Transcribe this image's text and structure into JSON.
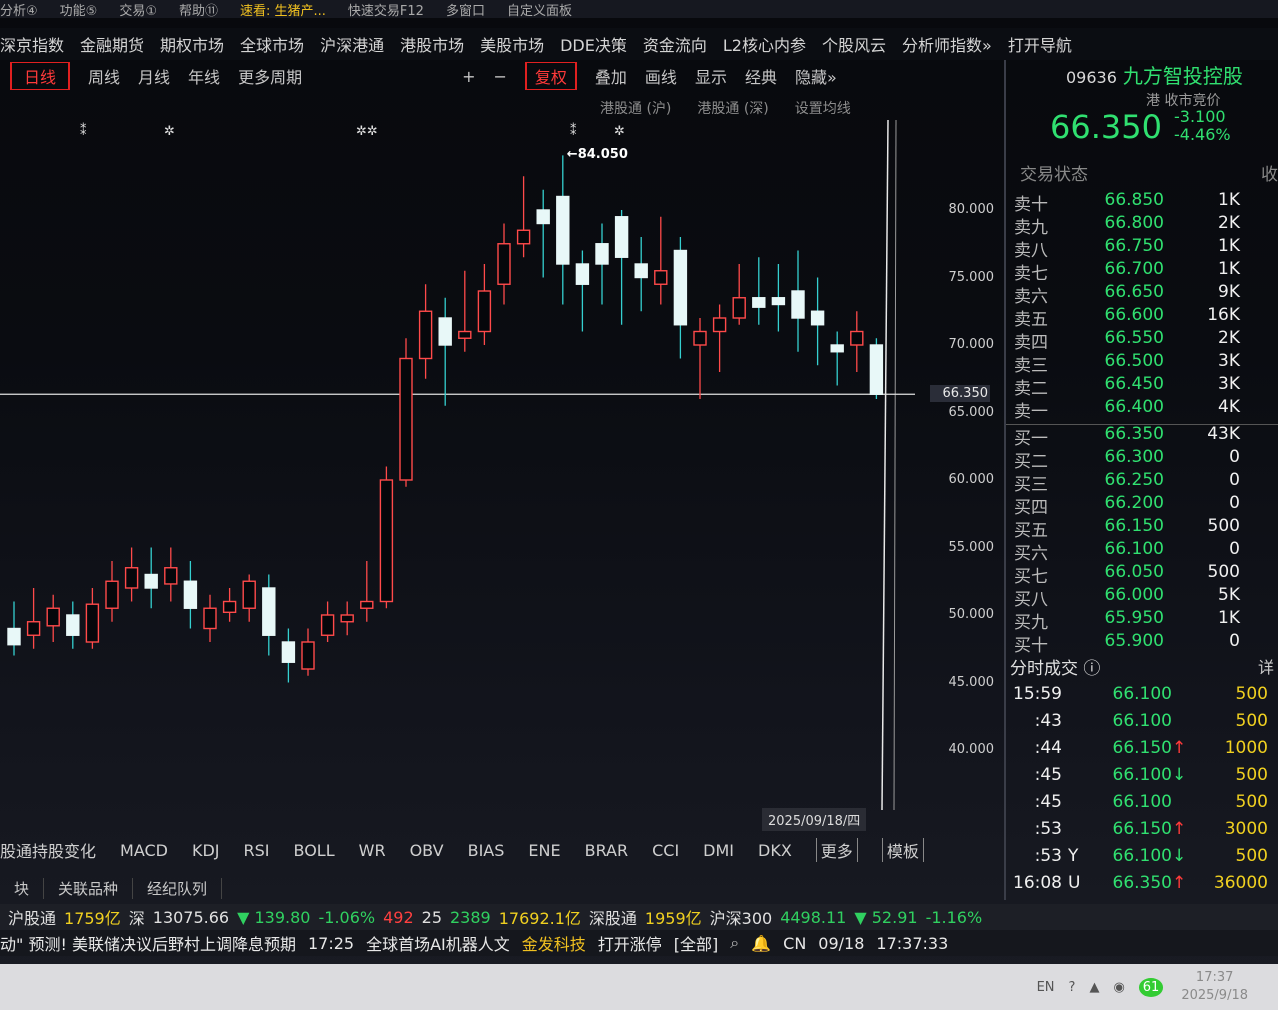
{
  "menu": {
    "items": [
      "分析④",
      "功能⑤",
      "交易①",
      "帮助⑪",
      "速看: 生猪产...",
      "快速交易F12",
      "多窗口",
      "自定义面板"
    ]
  },
  "nav": {
    "items": [
      "深京指数",
      "金融期货",
      "期权市场",
      "全球市场",
      "沪深港通",
      "港股市场",
      "美股市场",
      "DDE决策",
      "资金流向",
      "L2核心内参",
      "个股风云",
      "分析师指数»",
      "打开导航"
    ]
  },
  "toolbar": {
    "items": [
      "日线",
      "周线",
      "月线",
      "年线",
      "更多周期",
      "+",
      "−",
      "复权",
      "叠加",
      "画线",
      "显示",
      "经典",
      "隐藏»"
    ]
  },
  "subbar": {
    "items": [
      "港股通 (沪)",
      "港股通 (深)",
      "设置均线"
    ]
  },
  "chart": {
    "y_ticks": [
      "80.000",
      "75.000",
      "70.000",
      "65.000",
      "60.000",
      "55.000",
      "50.000",
      "45.000",
      "40.000"
    ],
    "current_price_tag": "66.350",
    "high_label": "84.050",
    "date_label": "2025/09/18/四"
  },
  "chart_data": {
    "type": "candlestick",
    "current_price": 66.35,
    "period_high": 84.05,
    "ylim": [
      37,
      85
    ],
    "candles": [
      {
        "o": 49.0,
        "c": 47.8,
        "h": 51,
        "l": 47
      },
      {
        "o": 48.5,
        "c": 49.5,
        "h": 52,
        "l": 47.5
      },
      {
        "o": 49.2,
        "c": 50.5,
        "h": 51.5,
        "l": 48
      },
      {
        "o": 50.0,
        "c": 48.5,
        "h": 51,
        "l": 47.5
      },
      {
        "o": 48.0,
        "c": 50.8,
        "h": 52,
        "l": 47.5
      },
      {
        "o": 50.5,
        "c": 52.5,
        "h": 54,
        "l": 49.5
      },
      {
        "o": 52.0,
        "c": 53.5,
        "h": 55,
        "l": 51
      },
      {
        "o": 53.0,
        "c": 52.0,
        "h": 55,
        "l": 50.5
      },
      {
        "o": 52.3,
        "c": 53.5,
        "h": 55,
        "l": 51
      },
      {
        "o": 52.5,
        "c": 50.5,
        "h": 54,
        "l": 49
      },
      {
        "o": 49.0,
        "c": 50.5,
        "h": 51.5,
        "l": 48
      },
      {
        "o": 50.2,
        "c": 51.0,
        "h": 52,
        "l": 49.5
      },
      {
        "o": 50.5,
        "c": 52.5,
        "h": 53,
        "l": 49.5
      },
      {
        "o": 52.0,
        "c": 48.5,
        "h": 53,
        "l": 47
      },
      {
        "o": 48.0,
        "c": 46.5,
        "h": 49,
        "l": 45
      },
      {
        "o": 46.0,
        "c": 48.0,
        "h": 49,
        "l": 45.5
      },
      {
        "o": 48.5,
        "c": 50.0,
        "h": 51,
        "l": 48
      },
      {
        "o": 49.5,
        "c": 50.0,
        "h": 51,
        "l": 48.5
      },
      {
        "o": 50.5,
        "c": 51.0,
        "h": 54,
        "l": 49.5
      },
      {
        "o": 51.0,
        "c": 60.0,
        "h": 61,
        "l": 50.5
      },
      {
        "o": 60.0,
        "c": 69.0,
        "h": 70.5,
        "l": 59.5
      },
      {
        "o": 69.0,
        "c": 72.5,
        "h": 74.5,
        "l": 67.5
      },
      {
        "o": 72.0,
        "c": 70.0,
        "h": 73.5,
        "l": 65.5
      },
      {
        "o": 70.5,
        "c": 71.0,
        "h": 75.5,
        "l": 69.5
      },
      {
        "o": 71.0,
        "c": 74.0,
        "h": 76,
        "l": 70
      },
      {
        "o": 74.5,
        "c": 77.5,
        "h": 79,
        "l": 73
      },
      {
        "o": 77.5,
        "c": 78.5,
        "h": 82.5,
        "l": 76.5
      },
      {
        "o": 80.0,
        "c": 79.0,
        "h": 81.5,
        "l": 75
      },
      {
        "o": 81.0,
        "c": 76.0,
        "h": 84.05,
        "l": 73
      },
      {
        "o": 76.0,
        "c": 74.5,
        "h": 77,
        "l": 71
      },
      {
        "o": 77.5,
        "c": 76.0,
        "h": 79,
        "l": 73
      },
      {
        "o": 79.5,
        "c": 76.5,
        "h": 80,
        "l": 71.5
      },
      {
        "o": 76.0,
        "c": 75.0,
        "h": 78,
        "l": 72.5
      },
      {
        "o": 74.5,
        "c": 75.5,
        "h": 79.5,
        "l": 73
      },
      {
        "o": 77.0,
        "c": 71.5,
        "h": 78,
        "l": 69
      },
      {
        "o": 70.0,
        "c": 71.0,
        "h": 72,
        "l": 66
      },
      {
        "o": 71.0,
        "c": 72.0,
        "h": 73,
        "l": 68
      },
      {
        "o": 72.0,
        "c": 73.5,
        "h": 76,
        "l": 71.5
      },
      {
        "o": 73.5,
        "c": 72.8,
        "h": 76.5,
        "l": 71.5
      },
      {
        "o": 73.5,
        "c": 73.0,
        "h": 76,
        "l": 71
      },
      {
        "o": 74.0,
        "c": 72.0,
        "h": 77,
        "l": 69.5
      },
      {
        "o": 72.5,
        "c": 71.5,
        "h": 75,
        "l": 68.5
      },
      {
        "o": 70.0,
        "c": 69.5,
        "h": 71,
        "l": 67
      },
      {
        "o": 70.0,
        "c": 71.0,
        "h": 72.5,
        "l": 68
      },
      {
        "o": 70.0,
        "c": 66.35,
        "h": 70.5,
        "l": 66.0
      }
    ]
  },
  "indicators": {
    "items": [
      "股通持股变化",
      "MACD",
      "KDJ",
      "RSI",
      "BOLL",
      "WR",
      "OBV",
      "BIAS",
      "ENE",
      "BRAR",
      "CCI",
      "DMI",
      "DKX",
      "更多",
      "模板"
    ]
  },
  "bottom_tabs": {
    "items": [
      "块",
      "关联品种",
      "经纪队列"
    ]
  },
  "status": {
    "sh_connect": "沪股通",
    "sh_amount": "1759亿",
    "sz_label": "深",
    "sz_index": "13075.66",
    "sz_change": "▼ 139.80",
    "sz_pct": "-1.06%",
    "up_count": "492",
    "flat_count": "25",
    "down_count": "2389",
    "turnover": "17692.1亿",
    "sz_connect": "深股通",
    "sz_amount": "1959亿",
    "hs300_label": "沪深300",
    "hs300_value": "4498.11",
    "hs300_change": "▼ 52.91",
    "hs300_pct": "-1.16%"
  },
  "ticker": {
    "news": "动\" 预测! 美联储决议后野村上调降息预期",
    "time": "17:25",
    "news2": "全球首场AI机器人文",
    "badge": "金发科技",
    "limit_up": "打开涨停",
    "all": "[全部]",
    "cn": "CN",
    "date": "09/18",
    "clock": "17:37:33"
  },
  "taskbar": {
    "time": "17:37",
    "date": "2025/9/18",
    "lang": "EN",
    "battery": "61"
  },
  "panel": {
    "code": "09636",
    "name": "九方智投控股",
    "market_label": "港 收市竞价",
    "last_price": "66.350",
    "change": "-3.100",
    "change_pct": "-4.46%",
    "trade_state": "交易状态",
    "trade_state_right": "收",
    "asks": [
      {
        "label": "卖十",
        "price": "66.850",
        "vol": "1K"
      },
      {
        "label": "卖九",
        "price": "66.800",
        "vol": "2K"
      },
      {
        "label": "卖八",
        "price": "66.750",
        "vol": "1K"
      },
      {
        "label": "卖七",
        "price": "66.700",
        "vol": "1K"
      },
      {
        "label": "卖六",
        "price": "66.650",
        "vol": "9K"
      },
      {
        "label": "卖五",
        "price": "66.600",
        "vol": "16K"
      },
      {
        "label": "卖四",
        "price": "66.550",
        "vol": "2K"
      },
      {
        "label": "卖三",
        "price": "66.500",
        "vol": "3K"
      },
      {
        "label": "卖二",
        "price": "66.450",
        "vol": "3K"
      },
      {
        "label": "卖一",
        "price": "66.400",
        "vol": "4K"
      }
    ],
    "bids": [
      {
        "label": "买一",
        "price": "66.350",
        "vol": "43K"
      },
      {
        "label": "买二",
        "price": "66.300",
        "vol": "0"
      },
      {
        "label": "买三",
        "price": "66.250",
        "vol": "0"
      },
      {
        "label": "买四",
        "price": "66.200",
        "vol": "0"
      },
      {
        "label": "买五",
        "price": "66.150",
        "vol": "500"
      },
      {
        "label": "买六",
        "price": "66.100",
        "vol": "0"
      },
      {
        "label": "买七",
        "price": "66.050",
        "vol": "500"
      },
      {
        "label": "买八",
        "price": "66.000",
        "vol": "5K"
      },
      {
        "label": "买九",
        "price": "65.950",
        "vol": "1K"
      },
      {
        "label": "买十",
        "price": "65.900",
        "vol": "0"
      }
    ],
    "trades_title": "分时成交",
    "trades_more": "详",
    "trades": [
      {
        "time": "15:59",
        "flag": "",
        "price": "66.100",
        "arrow": "",
        "vol": "500"
      },
      {
        "time": ":43",
        "flag": "",
        "price": "66.100",
        "arrow": "",
        "vol": "500"
      },
      {
        "time": ":44",
        "flag": "",
        "price": "66.150",
        "arrow": "↑",
        "vol": "1000"
      },
      {
        "time": ":45",
        "flag": "",
        "price": "66.100",
        "arrow": "↓",
        "vol": "500"
      },
      {
        "time": ":45",
        "flag": "",
        "price": "66.100",
        "arrow": "",
        "vol": "500"
      },
      {
        "time": ":53",
        "flag": "",
        "price": "66.150",
        "arrow": "↑",
        "vol": "3000"
      },
      {
        "time": ":53",
        "flag": "Y",
        "price": "66.100",
        "arrow": "↓",
        "vol": "500"
      },
      {
        "time": "16:08",
        "flag": "U",
        "price": "66.350",
        "arrow": "↑",
        "vol": "36000"
      }
    ]
  }
}
